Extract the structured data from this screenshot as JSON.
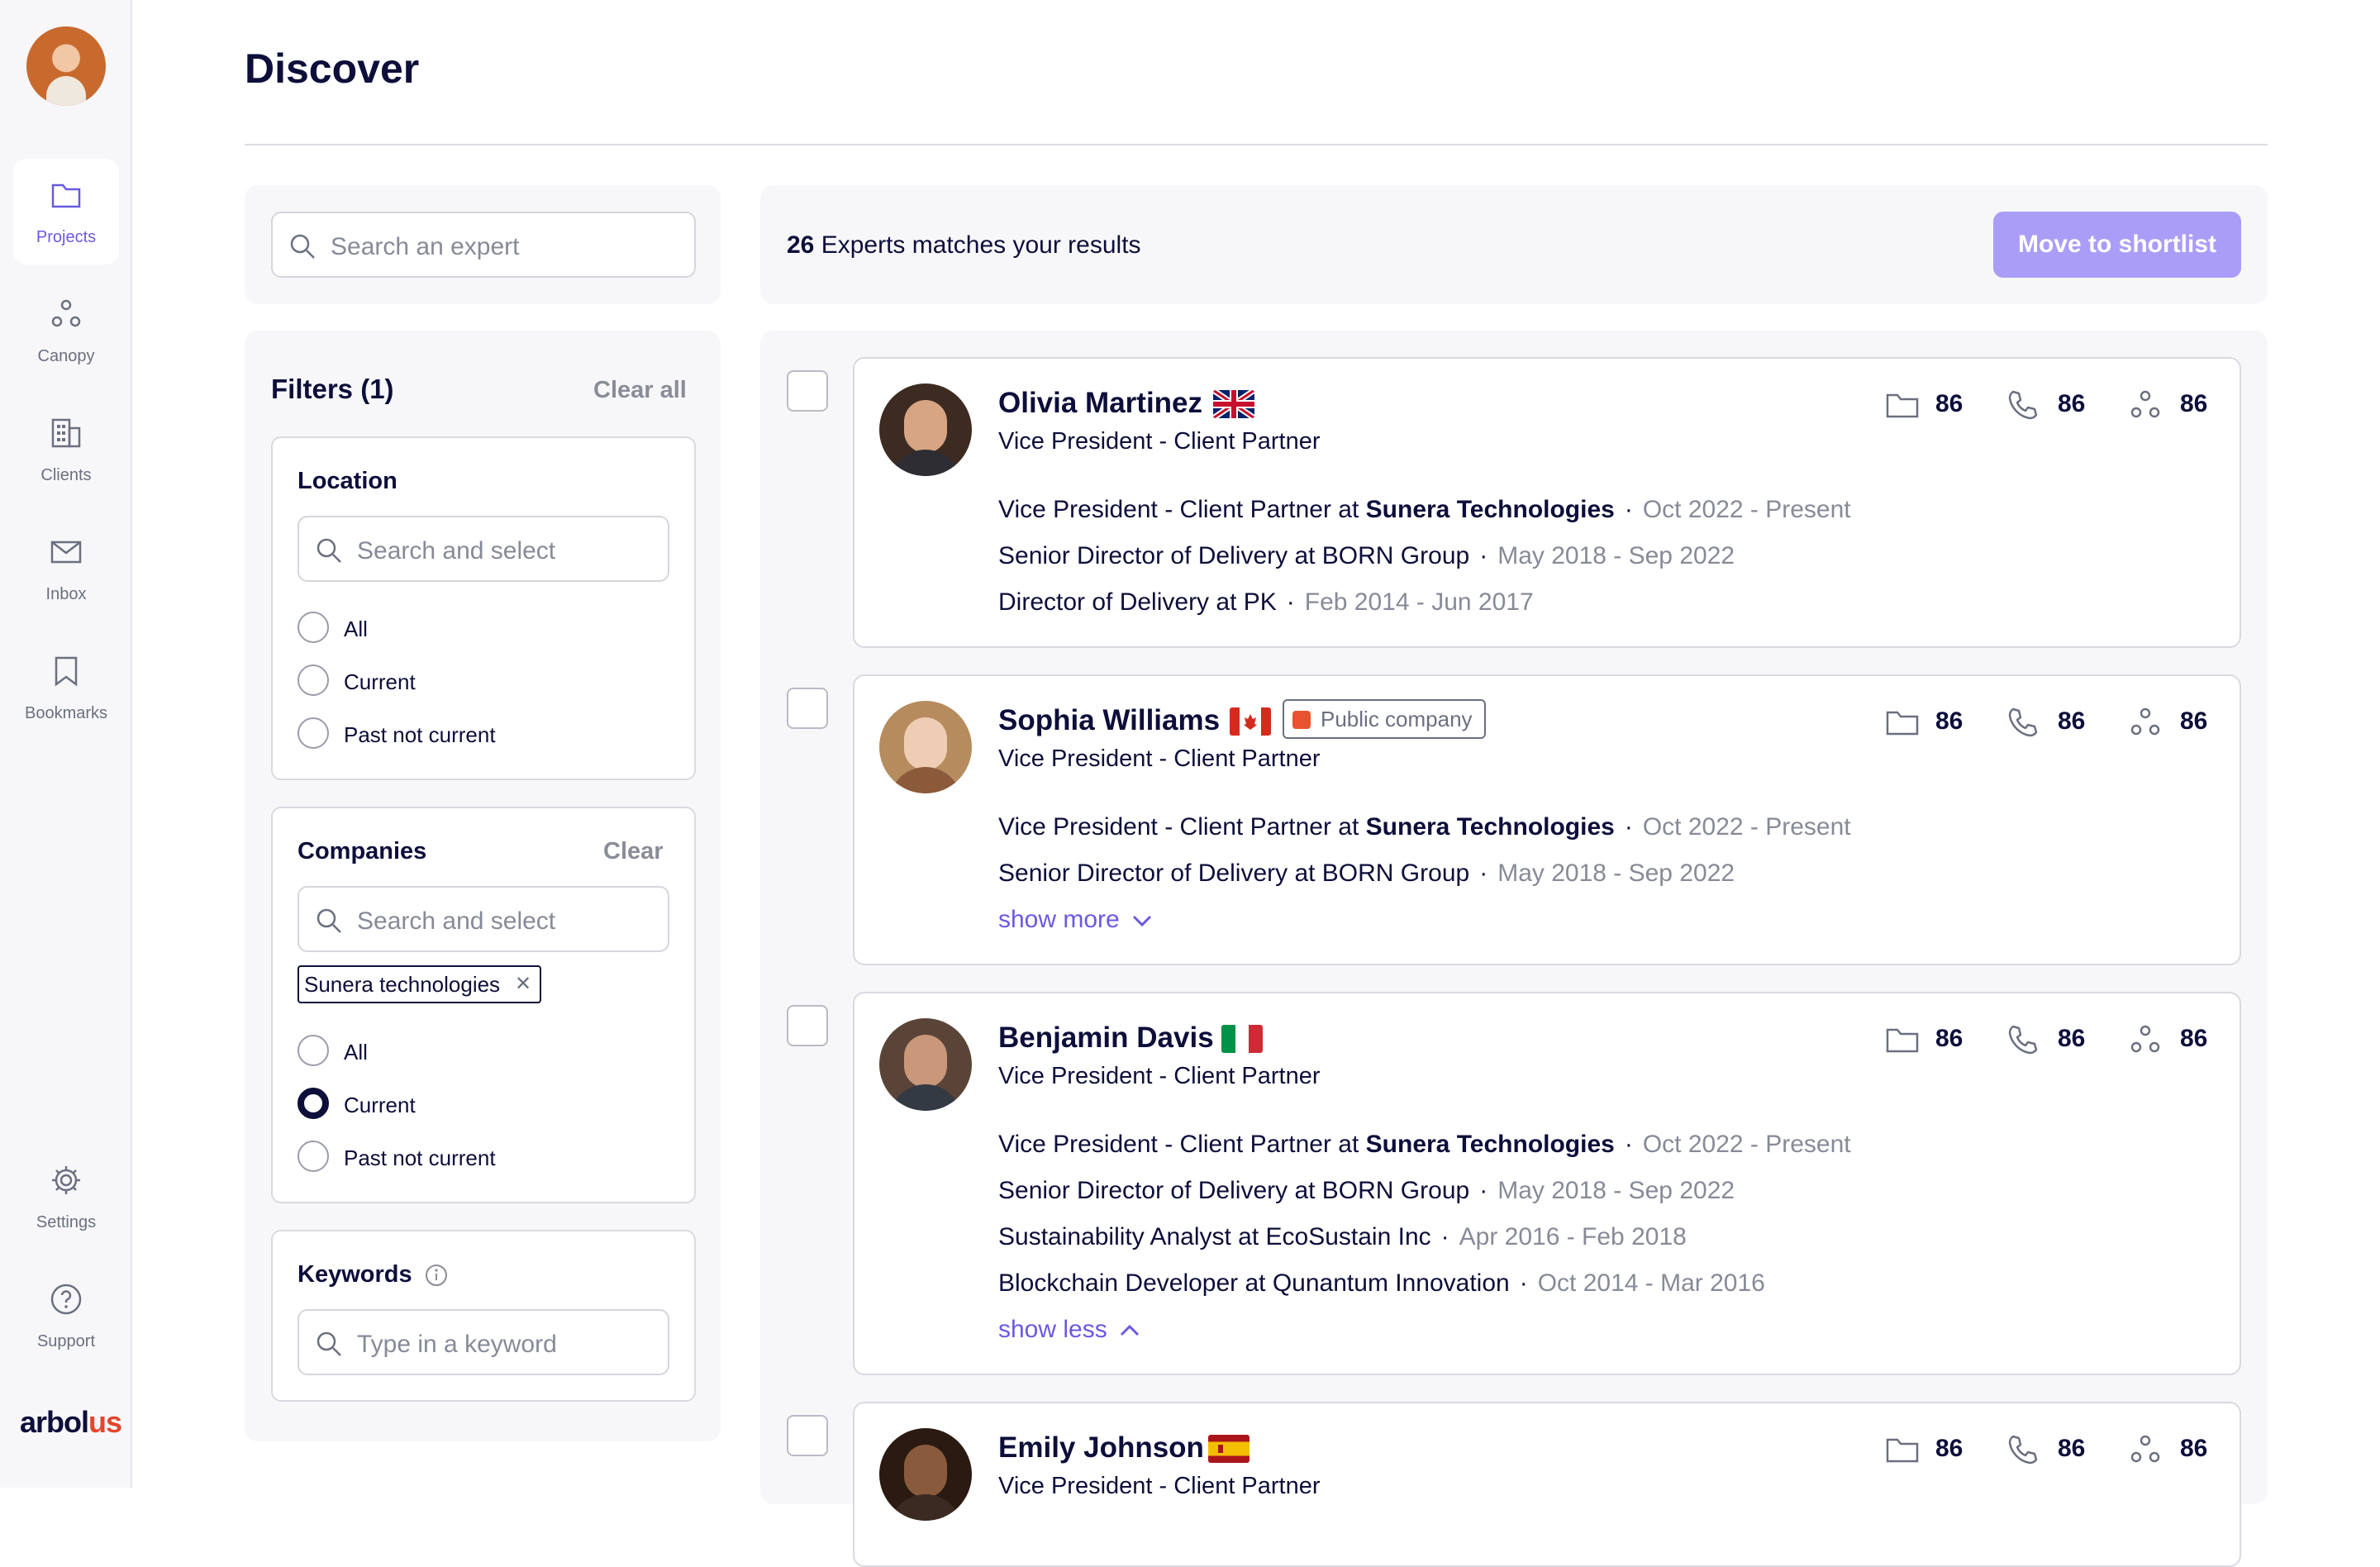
{
  "sidebar": {
    "items": [
      {
        "label": "Projects",
        "icon": "folder-icon"
      },
      {
        "label": "Canopy",
        "icon": "canopy-icon"
      },
      {
        "label": "Clients",
        "icon": "building-icon"
      },
      {
        "label": "Inbox",
        "icon": "mail-icon"
      },
      {
        "label": "Bookmarks",
        "icon": "bookmark-icon"
      }
    ],
    "bottom_items": [
      {
        "label": "Settings",
        "icon": "gear-icon"
      },
      {
        "label": "Support",
        "icon": "help-icon"
      }
    ],
    "brand_left": "arbol",
    "brand_right": "us"
  },
  "page": {
    "title": "Discover"
  },
  "search": {
    "placeholder": "Search an expert"
  },
  "filters": {
    "title": "Filters (1)",
    "clear_all": "Clear all",
    "location": {
      "title": "Location",
      "placeholder": "Search and select",
      "options": [
        "All",
        "Current",
        "Past not current"
      ],
      "selected": null
    },
    "companies": {
      "title": "Companies",
      "clear": "Clear",
      "placeholder": "Search and select",
      "chip": "Sunera technologies",
      "options": [
        "All",
        "Current",
        "Past not current"
      ],
      "selected": "Current"
    },
    "keywords": {
      "title": "Keywords",
      "placeholder": "Type in a keyword"
    }
  },
  "results": {
    "count": "26",
    "count_text": "Experts matches your results",
    "shortlist_button": "Move to shortlist"
  },
  "experts": [
    {
      "name": "Olivia Martinez",
      "flag": "GB",
      "title": "Vice President - Client Partner",
      "stats": {
        "projects": "86",
        "calls": "86",
        "network": "86"
      },
      "roles": [
        {
          "prefix": "Vice President - Client Partner at ",
          "company": "Sunera Technologies",
          "dates": "Oct 2022 - Present"
        },
        {
          "prefix": "Senior Director of Delivery at BORN Group",
          "company": "",
          "dates": "May 2018 - Sep 2022"
        },
        {
          "prefix": "Director of Delivery at PK",
          "company": "",
          "dates": "Feb 2014 - Jun 2017"
        }
      ]
    },
    {
      "name": "Sophia Williams",
      "flag": "CA",
      "badge": "Public company",
      "title": "Vice President - Client Partner",
      "stats": {
        "projects": "86",
        "calls": "86",
        "network": "86"
      },
      "roles": [
        {
          "prefix": "Vice President - Client Partner at ",
          "company": "Sunera Technologies",
          "dates": "Oct 2022 - Present"
        },
        {
          "prefix": "Senior Director of Delivery at BORN Group",
          "company": "",
          "dates": "May 2018 - Sep 2022"
        }
      ],
      "toggle": "show more"
    },
    {
      "name": "Benjamin Davis",
      "flag": "IT",
      "title": "Vice President - Client Partner",
      "stats": {
        "projects": "86",
        "calls": "86",
        "network": "86"
      },
      "roles": [
        {
          "prefix": "Vice President - Client Partner at ",
          "company": "Sunera Technologies",
          "dates": "Oct 2022 - Present"
        },
        {
          "prefix": "Senior Director of Delivery at BORN Group",
          "company": "",
          "dates": "May 2018 - Sep 2022"
        },
        {
          "prefix": "Sustainability Analyst at EcoSustain Inc",
          "company": "",
          "dates": "Apr 2016 - Feb 2018"
        },
        {
          "prefix": "Blockchain Developer at Qunantum Innovation",
          "company": "",
          "dates": "Oct 2014 - Mar 2016"
        }
      ],
      "toggle": "show less"
    },
    {
      "name": "Emily Johnson",
      "flag": "ES",
      "title": "Vice President - Client Partner",
      "stats": {
        "projects": "86",
        "calls": "86",
        "network": "86"
      }
    }
  ],
  "colors": {
    "accent": "#6a5ae0",
    "button_disabled": "#aa9df7",
    "text_primary": "#0d0e3a",
    "text_muted": "#878a97",
    "panel_bg": "#f7f7f9"
  }
}
